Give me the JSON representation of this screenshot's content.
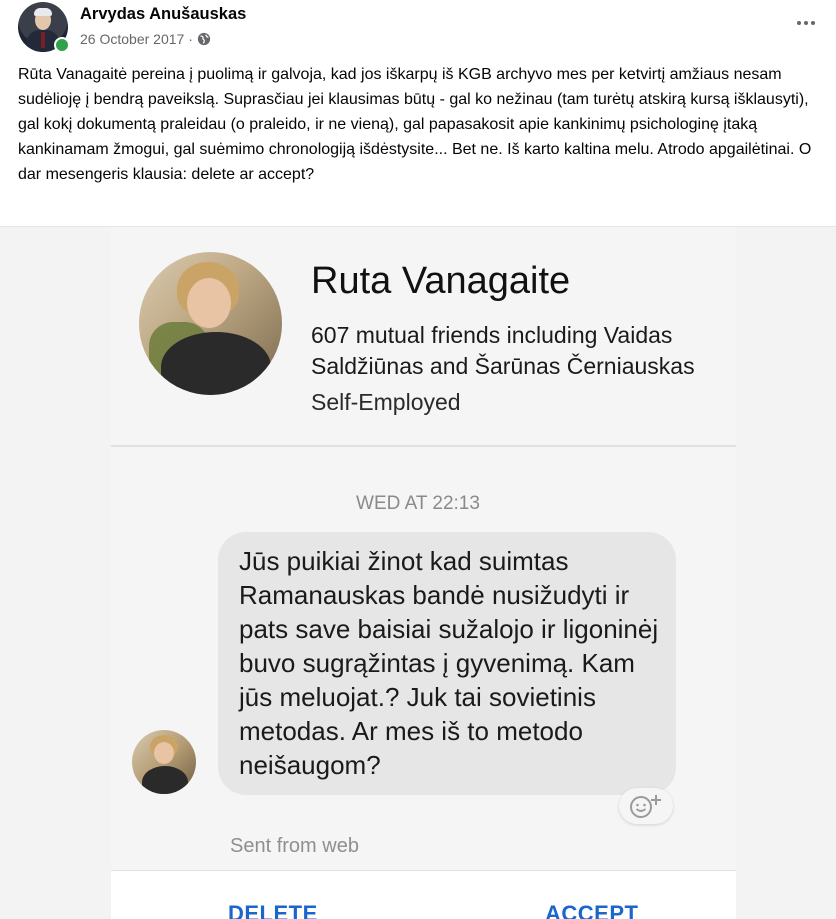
{
  "post": {
    "author": "Arvydas Anušauskas",
    "date": "26 October 2017",
    "separator": "·",
    "privacy_icon": "globe-icon",
    "more_icon": "more-options-icon",
    "text": "Rūta Vanagaitė pereina į puolimą ir galvoja, kad jos iškarpų iš KGB archyvo mes per ketvirtį amžiaus nesam sudėlioję į bendrą paveikslą. Suprasčiau jei klausimas būtų - gal ko nežinau (tam turėtų atskirą kursą išklausyti), gal kokį dokumentą praleidau (o praleido, ir ne vieną), gal papasakosit apie kankinimų psichologinę įtaką kankinamam žmogui, gal suėmimo chronologiją išdėstysite... Bet ne. Iš karto kaltina melu. Atrodo apgailėtinai. O dar mesengeris klausia: delete ar accept?"
  },
  "screenshot": {
    "profile": {
      "name": "Ruta Vanagaite",
      "mutual_friends": "607 mutual friends including Vaidas Saldžiūnas and Šarūnas Černiauskas",
      "work": "Self-Employed"
    },
    "timestamp": "WED AT 22:13",
    "message": "Jūs puikiai žinot kad suimtas Ramanauskas bandė nusižudyti ir pats save baisiai sužalojo ir ligoninėj buvo sugrąžintas į gyvenimą. Kam jūs meluojat.? Juk tai sovietinis metodas. Ar mes iš to metodo neišaugom?",
    "react_icon": "add-reaction-icon",
    "sent_from": "Sent from web",
    "actions": {
      "delete": "DELETE",
      "accept": "ACCEPT"
    }
  },
  "colors": {
    "online": "#31a24c",
    "action_blue": "#1a66cc",
    "bubble": "#e6e6e6",
    "meta_gray": "#65676b"
  }
}
